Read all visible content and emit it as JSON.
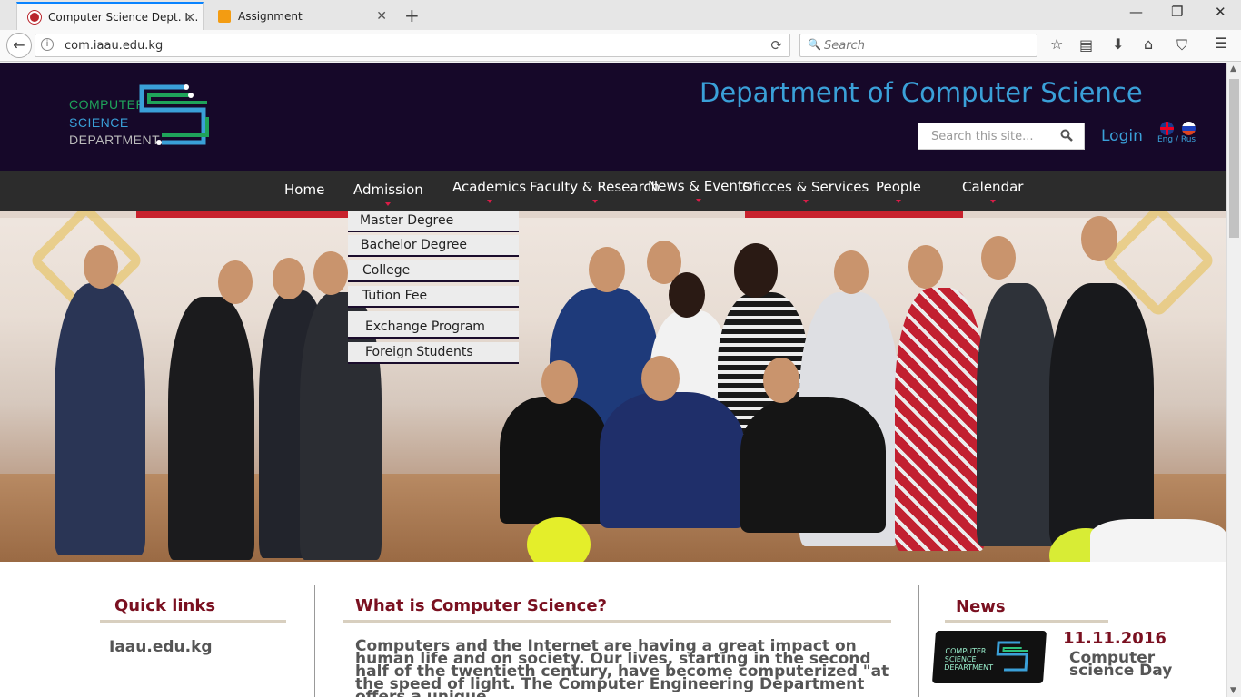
{
  "browser": {
    "tabs": [
      {
        "title": "Computer Science Dept. I...",
        "active": true
      },
      {
        "title": "Assignment",
        "active": false
      }
    ],
    "new_tab_symbol": "+",
    "window_controls": {
      "minimize": "—",
      "restore": "❐",
      "close": "✕"
    },
    "address": "com.iaau.edu.kg",
    "search_placeholder": "Search",
    "toolbar_icons": [
      "star-icon",
      "reading-list-icon",
      "download-icon",
      "home-icon",
      "pocket-icon",
      "menu-icon"
    ]
  },
  "site": {
    "logo": {
      "line1": "COMPUTER",
      "line2": "SCIENCE",
      "line3": "DEPARTMENT"
    },
    "title": "Department of Computer Science",
    "search_placeholder": "Search this site...",
    "login": "Login",
    "language": "Eng / Rus",
    "menu": [
      "Home",
      "Admission",
      "Academics",
      "Faculty & Research",
      "News & Events",
      "Oficces & Services",
      "People",
      "Calendar"
    ],
    "admission_dropdown": [
      "Master Degree",
      "Bachelor Degree",
      "College",
      "Tution Fee",
      "Exchange Program",
      "Foreign Students"
    ]
  },
  "content": {
    "quick_links": {
      "title": "Quick links",
      "items": [
        "Iaau.edu.kg"
      ]
    },
    "what_is_cs": {
      "title": "What is Computer Science?",
      "body": "Computers and the Internet are having a great impact on human life and on society. Our lives, starting in the second half of the twentieth century, have become computerized \"at the speed of light. The Computer Engineering Department offers a unique"
    },
    "news": {
      "title": "News",
      "items": [
        {
          "date": "11.11.2016",
          "headline": "Computer science Day",
          "thumb_text": "COMPUTER SCIENCE DEPARTMENT"
        }
      ]
    }
  },
  "colors": {
    "header_bg": "#160829",
    "accent_blue": "#3aa0d8",
    "menu_bg": "#2c2c2c",
    "section_title": "#7a1020",
    "logo_green": "#1fa35a"
  }
}
